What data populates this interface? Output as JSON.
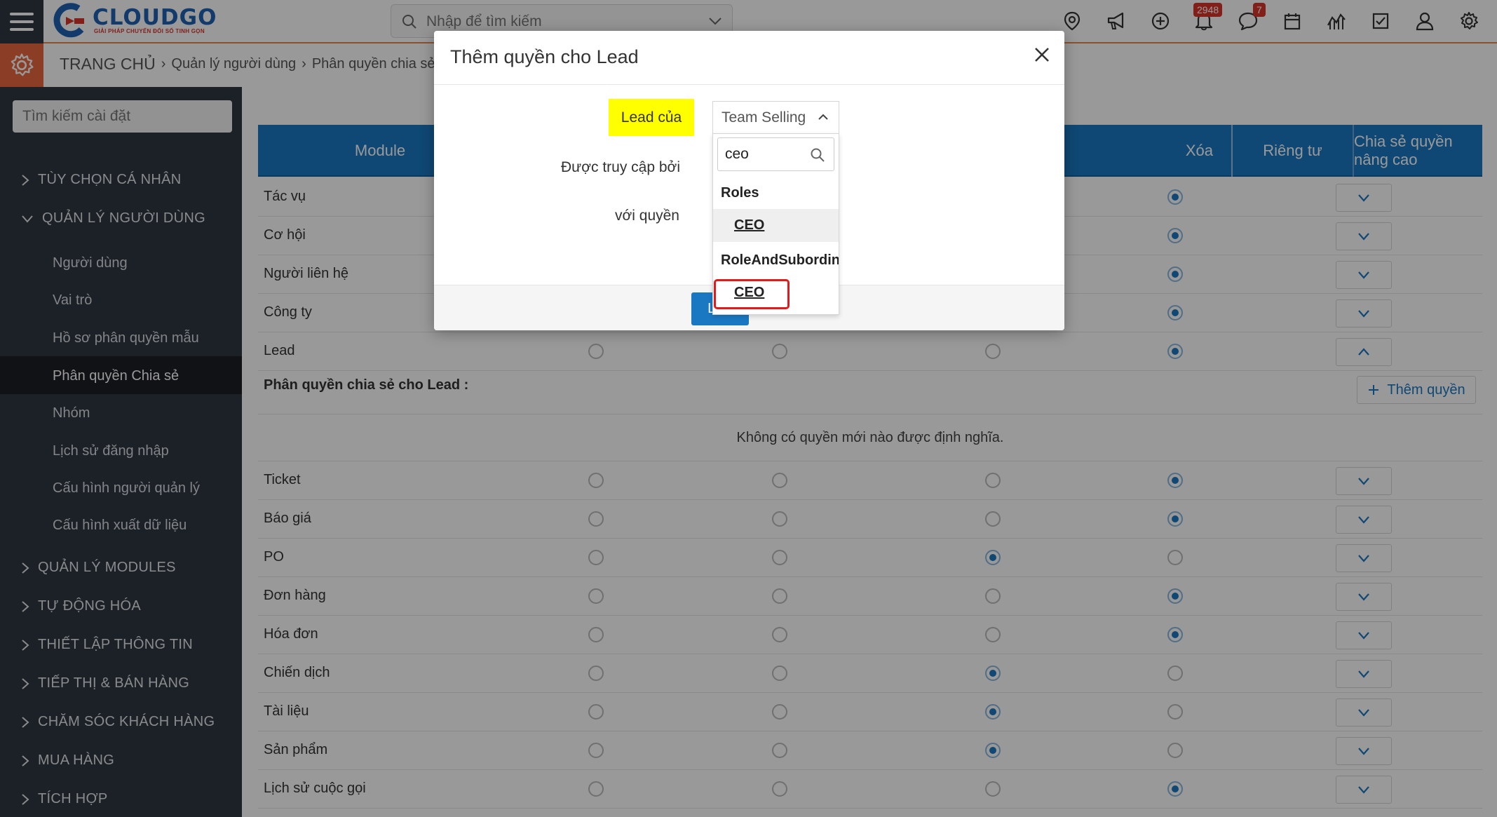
{
  "topbar": {
    "logo_title": "CLOUDGO",
    "logo_subtitle": "GIẢI PHÁP CHUYỂN ĐỔI SỐ TINH GỌN",
    "search_placeholder": "Nhập để tìm kiếm",
    "notification_count": "2948",
    "chat_count": "7",
    "icons": [
      "location-icon",
      "megaphone-icon",
      "add-circle-icon",
      "bell-icon",
      "chat-icon",
      "calendar-icon",
      "chart-icon",
      "task-check-icon",
      "user-icon",
      "settings-icon"
    ]
  },
  "breadcrumb": {
    "home": "TRANG CHỦ",
    "items": [
      "Quản lý người dùng",
      "Phân quyền chia sẻ"
    ]
  },
  "sidebar": {
    "search_placeholder": "Tìm kiếm cài đặt",
    "sections": [
      {
        "label": "TÙY CHỌN CÁ NHÂN"
      },
      {
        "label": "QUẢN LÝ NGƯỜI DÙNG"
      },
      {
        "label": "QUẢN LÝ MODULES"
      },
      {
        "label": "TỰ ĐỘNG HÓA"
      },
      {
        "label": "THIẾT LẬP THÔNG TIN"
      },
      {
        "label": "TIẾP THỊ & BÁN HÀNG"
      },
      {
        "label": "CHĂM SÓC KHÁCH HÀNG"
      },
      {
        "label": "MUA HÀNG"
      },
      {
        "label": "TÍCH HỢP"
      }
    ],
    "user_mgmt_items": [
      {
        "label": "Người dùng"
      },
      {
        "label": "Vai trò"
      },
      {
        "label": "Hồ sơ phân quyền mẫu"
      },
      {
        "label": "Phân quyền Chia sẻ"
      },
      {
        "label": "Nhóm"
      },
      {
        "label": "Lịch sử đăng nhập"
      },
      {
        "label": "Cấu hình người quản lý"
      },
      {
        "label": "Cấu hình xuất dữ liệu"
      }
    ],
    "active_item": "Phân quyền Chia sẻ"
  },
  "table": {
    "headers": {
      "module": "Module",
      "delete": "Xóa",
      "private": "Riêng tư",
      "advanced": "Chia sẻ quyền nâng cao"
    },
    "rows_top": [
      {
        "label": "Tác vụ"
      },
      {
        "label": "Cơ hội"
      },
      {
        "label": "Người liên hệ"
      },
      {
        "label": "Công ty"
      },
      {
        "label": "Lead"
      }
    ],
    "lead_subsection": {
      "title": "Phân quyền chia sẻ cho Lead :",
      "add_button": "Thêm quyền",
      "empty_text": "Không có quyền mới nào được định nghĩa."
    },
    "rows_bottom": [
      {
        "label": "Ticket"
      },
      {
        "label": "Báo giá"
      },
      {
        "label": "PO"
      },
      {
        "label": "Đơn hàng"
      },
      {
        "label": "Hóa đơn"
      },
      {
        "label": "Chiến dịch"
      },
      {
        "label": "Tài liệu"
      },
      {
        "label": "Sản phẩm"
      },
      {
        "label": "Lịch sử cuộc gọi"
      }
    ]
  },
  "modal": {
    "title": "Thêm quyền cho Lead",
    "lead_of_label": "Lead của",
    "accessed_by_label": "Được truy cập bởi",
    "with_permission_label": "với quyền",
    "save_label": "Lưu",
    "dropdown": {
      "selected": "Team Selling",
      "search_value": "ceo",
      "groups": [
        {
          "name": "Roles",
          "options": [
            "CEO"
          ]
        },
        {
          "name": "RoleAndSubordinates",
          "options": [
            "CEO"
          ]
        }
      ]
    }
  },
  "colors": {
    "header_blue": "#1a78c2",
    "sidebar_dark": "#2f3742",
    "accent_orange": "#e8683f",
    "highlight_yellow": "#ffff00",
    "highlight_red": "#e01b1b"
  }
}
